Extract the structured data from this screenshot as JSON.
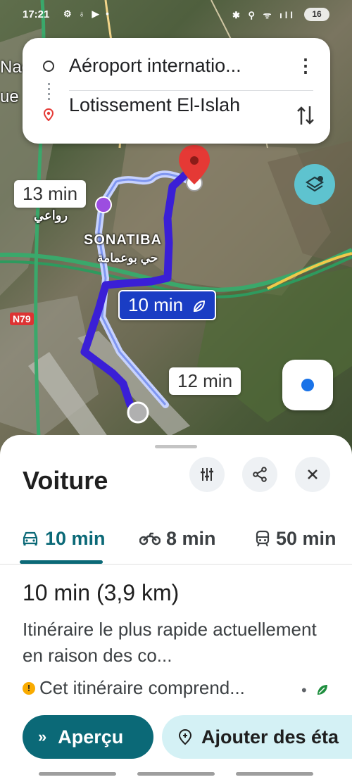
{
  "status_bar": {
    "time": "17:21",
    "left_icons": "⚙ ♁ ▶ •",
    "right_icons": "✱ ⚲ ᯤ ıll",
    "battery": "16"
  },
  "route": {
    "origin": "Aéroport internatio...",
    "destination": "Lotissement El-Islah"
  },
  "map": {
    "alt_route_1_time": "13 min",
    "alt_route_2_time": "12 min",
    "main_route_time": "10 min",
    "place_label": "SONATIBA",
    "arabic_label_1": "رواعي",
    "arabic_label_2": "حي بوعمامة",
    "road_shield": "N79",
    "edge_label_1": "Nac",
    "edge_label_2": "ue"
  },
  "sheet": {
    "title": "Voiture",
    "modes": [
      {
        "label": "10 min",
        "icon": "car-icon"
      },
      {
        "label": "8 min",
        "icon": "motorcycle-icon"
      },
      {
        "label": "50 min",
        "icon": "train-icon"
      }
    ],
    "summary": "10 min (3,9 km)",
    "description": "Itinéraire le plus rapide actuellement en raison des co...",
    "warning": "Cet itinéraire comprend...",
    "bullet": "•",
    "apercu_label": "Aperçu",
    "add_stops_label": "Ajouter des éta"
  },
  "colors": {
    "accent": "#0b6977",
    "route_main": "#3a1fd6",
    "route_alt": "#c7d2fe",
    "destination_pin": "#e53935"
  }
}
